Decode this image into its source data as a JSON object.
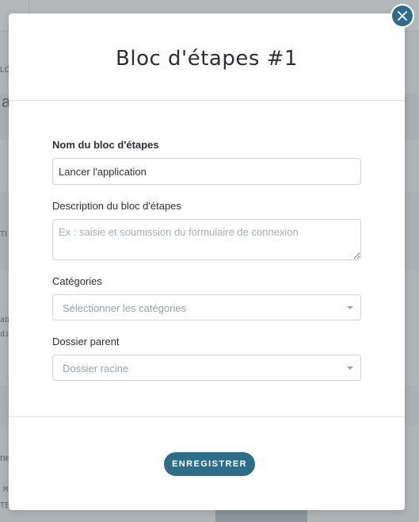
{
  "modal": {
    "title": "Bloc d'étapes #1",
    "fields": {
      "name": {
        "label": "Nom du bloc d'étapes",
        "value": "Lancer l'application"
      },
      "description": {
        "label": "Description du bloc d'étapes",
        "placeholder": "Ex : saisie et soumission du formulaire de connexion"
      },
      "categories": {
        "label": "Catégories",
        "placeholder": "Sélectionner les catégories"
      },
      "parent_folder": {
        "label": "Dossier parent",
        "placeholder": "Dossier racine"
      }
    },
    "save_label": "ENREGISTRER",
    "close_icon": "close-icon"
  },
  "background": {
    "fragments": [
      "LO",
      "a",
      "TI",
      "ab.",
      "di",
      "ne",
      "M",
      "TE"
    ]
  },
  "colors": {
    "accent": "#2c6e8a",
    "overlay": "rgba(45,52,58,0.32)"
  }
}
